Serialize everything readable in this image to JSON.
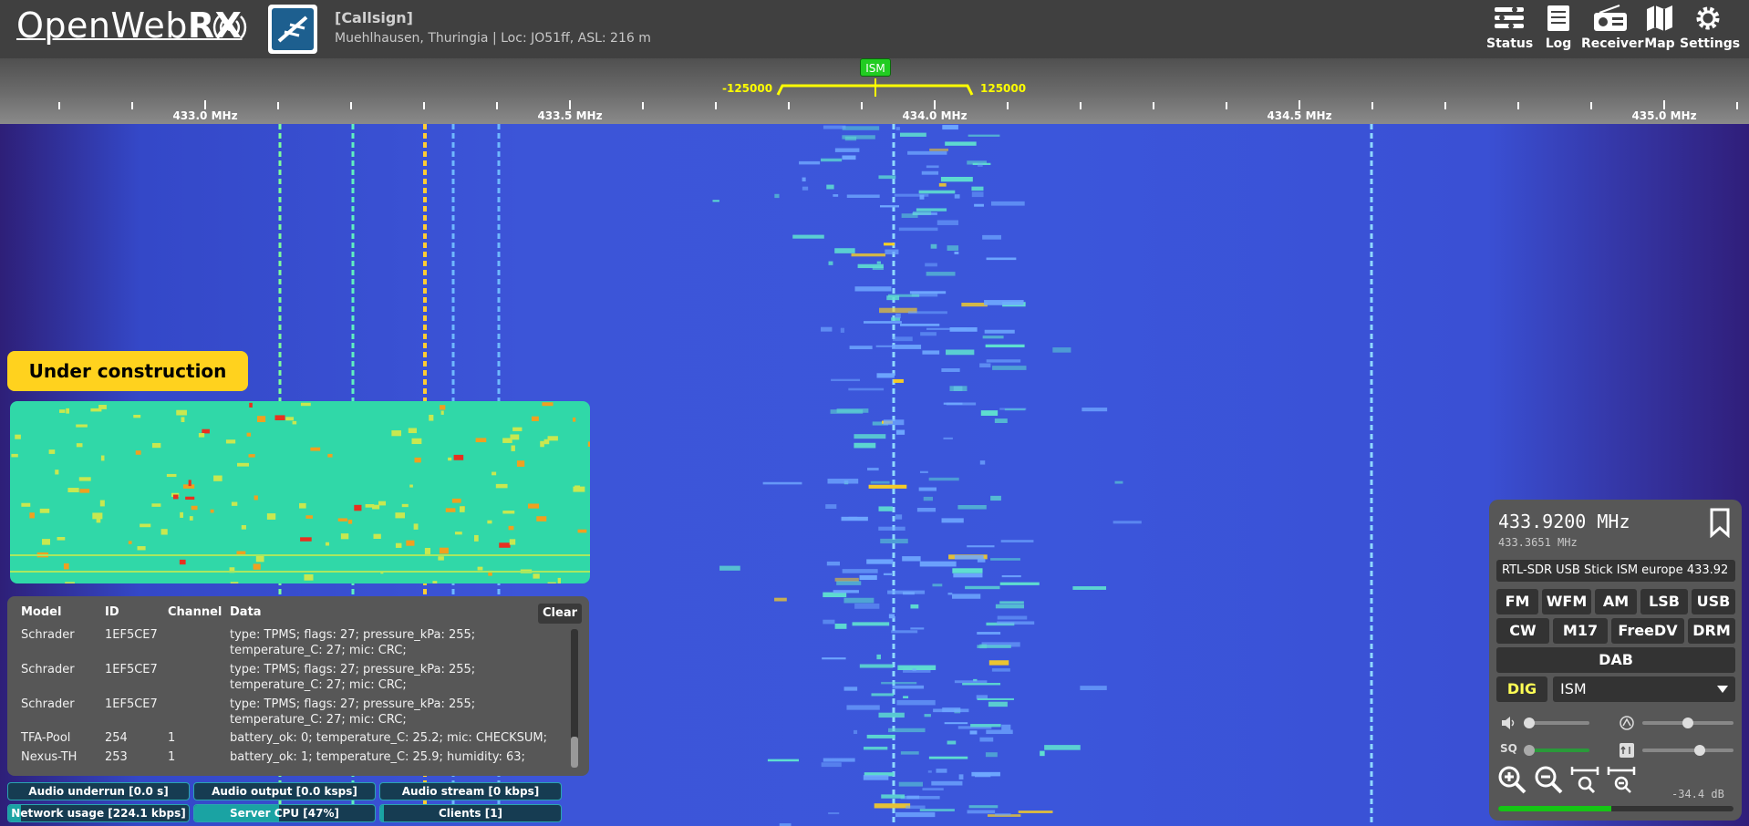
{
  "header": {
    "logo_text": "OpenWebRX",
    "callsign": "[Callsign]",
    "location": "Muehlhausen, Thuringia | Loc: JO51ff, ASL: 216 m",
    "nav": [
      {
        "label": "Status",
        "icon": "status-icon"
      },
      {
        "label": "Log",
        "icon": "log-icon"
      },
      {
        "label": "Receiver",
        "icon": "receiver-icon"
      },
      {
        "label": "Map",
        "icon": "map-icon"
      },
      {
        "label": "Settings",
        "icon": "settings-icon"
      }
    ]
  },
  "scale": {
    "labels": [
      "433.0 MHz",
      "433.5 MHz",
      "434.0 MHz",
      "434.5 MHz",
      "435.0 MHz"
    ],
    "bookmark": "ISM",
    "bandwidth_low": "-125000",
    "bandwidth_high": "125000"
  },
  "overlay": {
    "under_construction": "Under construction"
  },
  "decoder": {
    "headers": {
      "model": "Model",
      "id": "ID",
      "channel": "Channel",
      "data": "Data"
    },
    "clear_label": "Clear",
    "rows": [
      {
        "model": "Schrader",
        "id": "1EF5CE7",
        "channel": "",
        "data": "type: TPMS; flags: 27; pressure_kPa: 255; temperature_C: 27; mic: CRC;"
      },
      {
        "model": "Schrader",
        "id": "1EF5CE7",
        "channel": "",
        "data": "type: TPMS; flags: 27; pressure_kPa: 255; temperature_C: 27; mic: CRC;"
      },
      {
        "model": "Schrader",
        "id": "1EF5CE7",
        "channel": "",
        "data": "type: TPMS; flags: 27; pressure_kPa: 255; temperature_C: 27; mic: CRC;"
      },
      {
        "model": "TFA-Pool",
        "id": "254",
        "channel": "1",
        "data": "battery_ok: 0; temperature_C: 25.2; mic: CHECKSUM;"
      },
      {
        "model": "Nexus-TH",
        "id": "253",
        "channel": "1",
        "data": "battery_ok: 1; temperature_C: 25.9; humidity: 63;"
      }
    ]
  },
  "status_bars": [
    {
      "label": "Audio underrun [0.0 s]",
      "fill": 0
    },
    {
      "label": "Audio output [0.0 ksps]",
      "fill": 0
    },
    {
      "label": "Audio stream [0 kbps]",
      "fill": 0
    },
    {
      "label": "Network usage [224.1 kbps]",
      "fill": 0.07
    },
    {
      "label": "Server CPU [47%]",
      "fill": 0.47
    },
    {
      "label": "Clients [1]",
      "fill": 0.02
    }
  ],
  "receiver": {
    "frequency": "433.9200 MHz",
    "offset_frequency": "433.3651 MHz",
    "profile": "RTL-SDR USB Stick ISM europe 433.92",
    "modes_row1": [
      "FM",
      "WFM",
      "AM",
      "LSB",
      "USB"
    ],
    "modes_row2": [
      "CW",
      "M17",
      "FreeDV",
      "DRM"
    ],
    "modes_row3": [
      "DAB"
    ],
    "dig_label": "DIG",
    "dig_mode": "ISM",
    "volume": 0.0,
    "squelch": 0.0,
    "nr_level": 0.5,
    "agc_level": 0.65,
    "smeter_text": "-34.4 dB",
    "smeter_level": 0.48,
    "colors": {
      "dig_active": "#ffff55",
      "smeter": "#15c515",
      "accent": "#ffd21e"
    }
  }
}
